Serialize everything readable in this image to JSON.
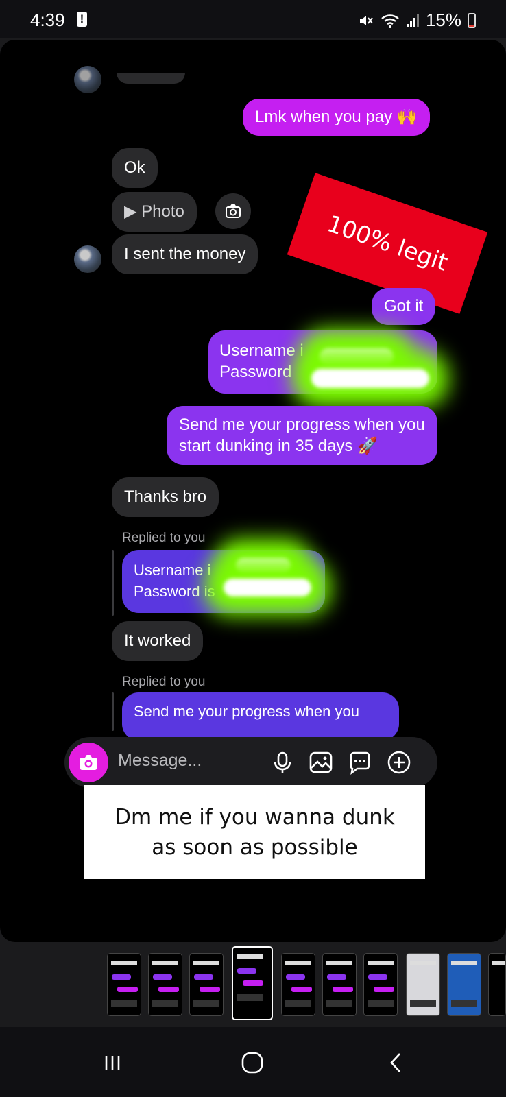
{
  "status": {
    "time": "4:39",
    "alert": "!",
    "battery": "15%"
  },
  "messages": {
    "lmk": "Lmk when you pay 🙌",
    "ok": "Ok",
    "photo": "▶ Photo",
    "sent": "I sent the money",
    "got_it": "Got it",
    "username_partial": "Username i",
    "password_partial": "Password",
    "progress": "Send me your progress when you start dunking in 35 days 🚀",
    "thanks": "Thanks bro",
    "replied_1": "Replied to you",
    "quote_username": "Username i",
    "quote_password": "Password is",
    "worked": "It worked",
    "replied_2": "Replied to you",
    "quote_progress": "Send me your progress when you"
  },
  "stickers": {
    "legit": "100% legit",
    "caption": "Dm me if you wanna dunk as soon as possible"
  },
  "composer": {
    "placeholder": "Message..."
  },
  "tray": {
    "thumbnail_count": 10
  },
  "icons": [
    "camera-icon",
    "mic-icon",
    "gallery-icon",
    "sticker-icon",
    "plus-icon",
    "recents-icon",
    "home-icon",
    "back-icon"
  ]
}
